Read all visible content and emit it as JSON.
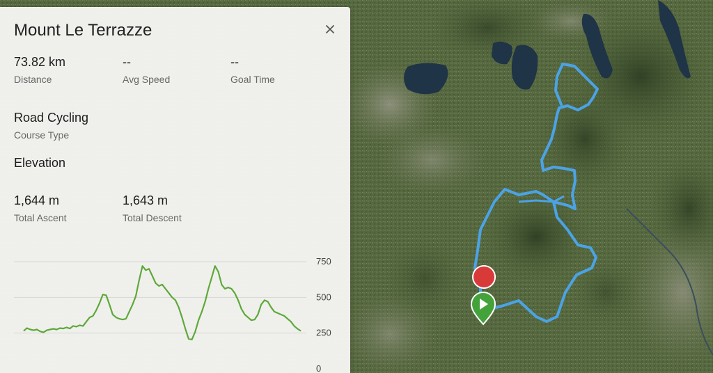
{
  "course": {
    "title": "Mount Le Terrazze",
    "close_icon": "close-icon"
  },
  "stats": {
    "distance": {
      "value": "73.82 km",
      "label": "Distance"
    },
    "avg_speed": {
      "value": "--",
      "label": "Avg Speed"
    },
    "goal_time": {
      "value": "--",
      "label": "Goal Time"
    }
  },
  "course_type": {
    "value": "Road Cycling",
    "label": "Course Type"
  },
  "elevation": {
    "title": "Elevation",
    "total_ascent": {
      "value": "1,644 m",
      "label": "Total Ascent"
    },
    "total_descent": {
      "value": "1,643 m",
      "label": "Total Descent"
    }
  },
  "chart_data": {
    "type": "line",
    "series": [
      {
        "values": [
          265,
          285,
          275,
          270,
          275,
          262,
          255,
          270,
          275,
          280,
          275,
          285,
          282,
          290,
          282,
          300,
          295,
          305,
          300,
          330,
          360,
          370,
          410,
          460,
          520,
          515,
          450,
          380,
          360,
          350,
          345,
          350,
          400,
          450,
          510,
          620,
          720,
          690,
          700,
          650,
          600,
          580,
          590,
          560,
          530,
          500,
          480,
          430,
          360,
          280,
          210,
          205,
          260,
          340,
          400,
          470,
          560,
          640,
          720,
          680,
          590,
          560,
          570,
          560,
          530,
          480,
          420,
          380,
          360,
          340,
          345,
          380,
          450,
          480,
          470,
          430,
          400,
          390,
          380,
          370,
          350,
          330,
          300,
          280,
          265
        ]
      }
    ],
    "yticks": [
      0,
      250,
      500,
      750
    ],
    "ylim": [
      0,
      800
    ],
    "color": "#5fa83a",
    "grid": true
  },
  "map": {
    "route_color": "#4ba3e6",
    "start_marker_color": "#43a33a",
    "end_marker_color": "#d83a3a",
    "start_icon": "play-icon"
  }
}
